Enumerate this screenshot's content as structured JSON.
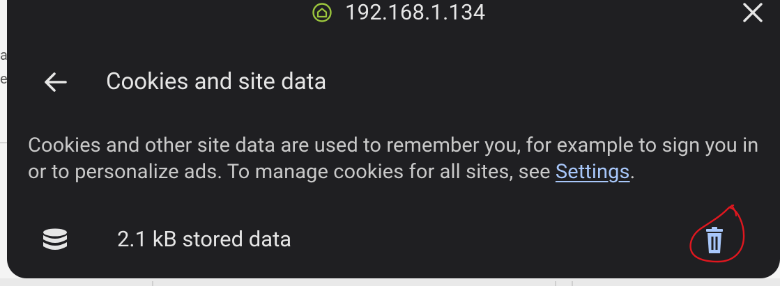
{
  "background": {
    "fragment_lines": [
      "a",
      "e"
    ]
  },
  "address_bar": {
    "site_icon": "home-outline-icon",
    "host": "192.168.1.134",
    "close_icon": "close-icon"
  },
  "header": {
    "back_icon": "arrow-back-icon",
    "title": "Cookies and site data"
  },
  "description": {
    "text_before_link": "Cookies and other site data are used to remember you, for example to sign you in or to personalize ads. To manage cookies for all sites, see ",
    "link_label": "Settings",
    "text_after_link": "."
  },
  "data_row": {
    "icon": "database-icon",
    "label": "2.1 kB stored data",
    "delete_icon": "trash-icon"
  },
  "colors": {
    "sheet_background": "#1f1f22",
    "link": "#a8c7fa",
    "site_icon": "#9bc53d",
    "delete_icon": "#a8c7fa",
    "annotation": "#e0171f"
  }
}
